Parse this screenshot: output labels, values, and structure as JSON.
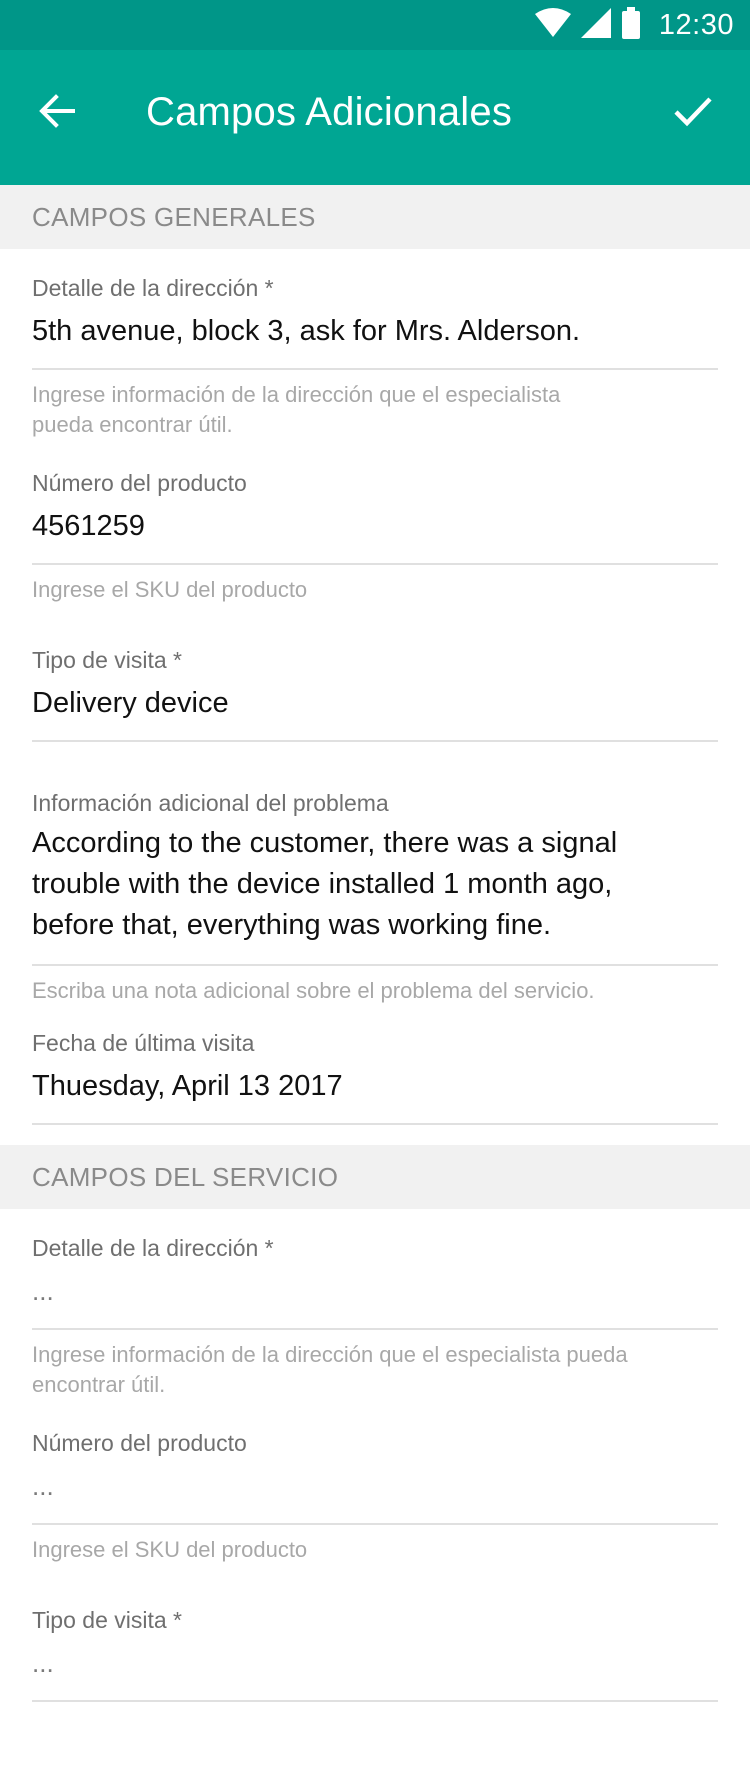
{
  "status_bar": {
    "time": "12:30",
    "icons": [
      "wifi-icon",
      "cell-signal-icon",
      "battery-icon"
    ]
  },
  "app_bar": {
    "title": "Campos Adicionales",
    "back_icon": "arrow-left-icon",
    "confirm_icon": "check-icon"
  },
  "sections": [
    {
      "header": "CAMPOS GENERALES",
      "fields": [
        {
          "label": "Detalle de la dirección *",
          "value": "5th avenue, block 3, ask for Mrs. Alderson.",
          "helper": "Ingrese información de la dirección que el especialista pueda encontrar útil."
        },
        {
          "label": "Número del producto",
          "value": "4561259",
          "helper": "Ingrese el SKU del producto"
        },
        {
          "label": "Tipo de visita *",
          "value": "Delivery device",
          "helper": ""
        },
        {
          "label": "Información adicional del problema",
          "value": "According to the customer, there was a signal trouble with the device installed 1 month ago, before that, everything was working fine.",
          "helper": "Escriba una nota adicional sobre el problema del servicio."
        },
        {
          "label": "Fecha de última visita",
          "value": "Thuesday, April 13 2017",
          "helper": ""
        }
      ]
    },
    {
      "header": "CAMPOS DEL SERVICIO",
      "fields": [
        {
          "label": "Detalle de la dirección *",
          "value": "...",
          "helper": "Ingrese información de la dirección que el especialista pueda encontrar útil."
        },
        {
          "label": "Número del producto",
          "value": "...",
          "helper": "Ingrese el SKU del producto"
        },
        {
          "label": "Tipo de visita *",
          "value": "...",
          "helper": ""
        }
      ]
    }
  ],
  "colors": {
    "status_bar": "#009688",
    "app_bar": "#00a693",
    "section_bg": "#f1f1f1"
  }
}
